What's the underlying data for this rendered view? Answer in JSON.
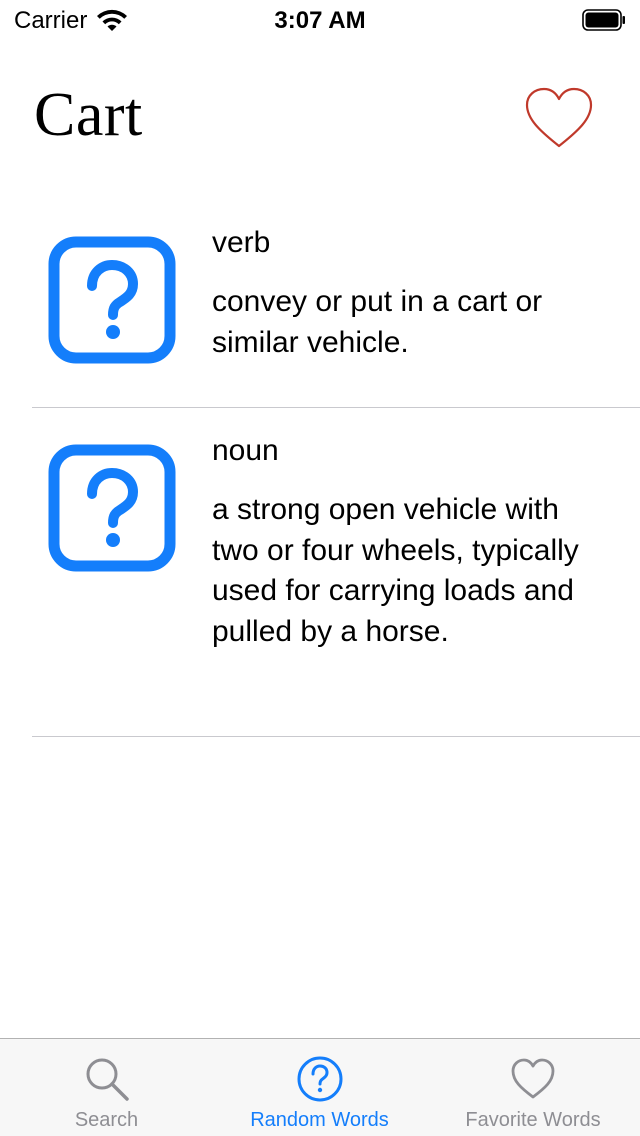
{
  "status_bar": {
    "carrier": "Carrier",
    "time": "3:07 AM"
  },
  "header": {
    "word": "Cart",
    "favorite_icon": "heart-outline-icon",
    "favorite_color": "#c0392b"
  },
  "definitions": [
    {
      "part_of_speech": "verb",
      "meaning": "convey or put in a cart or similar vehicle.",
      "icon": "question-square-icon"
    },
    {
      "part_of_speech": "noun",
      "meaning": "a strong open vehicle with two or four wheels, typically used for carrying loads and pulled by a horse.",
      "icon": "question-square-icon"
    }
  ],
  "tab_bar": {
    "tabs": [
      {
        "label": "Search",
        "icon": "search-icon",
        "active": false
      },
      {
        "label": "Random Words",
        "icon": "question-circle-icon",
        "active": true
      },
      {
        "label": "Favorite Words",
        "icon": "heart-icon",
        "active": false
      }
    ]
  },
  "colors": {
    "accent": "#147efb",
    "inactive": "#8e8e93",
    "separator": "#c9c9ce"
  }
}
